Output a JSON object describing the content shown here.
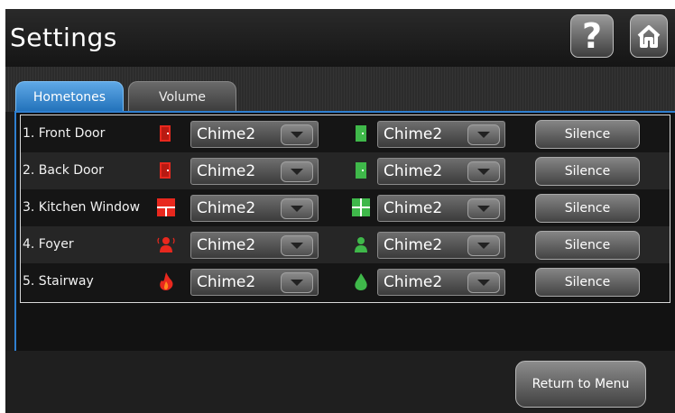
{
  "header": {
    "title": "Settings"
  },
  "icons": {
    "help": "help-icon",
    "home": "home-icon"
  },
  "tabs": [
    {
      "label": "Hometones",
      "selected": true
    },
    {
      "label": "Volume",
      "selected": false
    }
  ],
  "zones": [
    {
      "name": "1. Front Door",
      "icon": "door-icon",
      "tone_a": "Chime2",
      "tone_b": "Chime2",
      "silence_label": "Silence"
    },
    {
      "name": "2. Back Door",
      "icon": "door-icon",
      "tone_a": "Chime2",
      "tone_b": "Chime2",
      "silence_label": "Silence"
    },
    {
      "name": "3. Kitchen Window",
      "icon": "window-icon",
      "tone_a": "Chime2",
      "tone_b": "Chime2",
      "silence_label": "Silence"
    },
    {
      "name": "4. Foyer",
      "icon": "motion-sensor-icon",
      "tone_a": "Chime2",
      "tone_b": "Chime2",
      "silence_label": "Silence"
    },
    {
      "name": "5. Stairway",
      "icon": "fire-icon",
      "tone_a": "Chime2",
      "tone_b": "Chime2",
      "silence_label": "Silence"
    }
  ],
  "colors": {
    "accent": "#2f7fd0",
    "alarm": "#e8281e",
    "ok": "#3fb84a"
  },
  "footer": {
    "return_label": "Return to Menu"
  }
}
